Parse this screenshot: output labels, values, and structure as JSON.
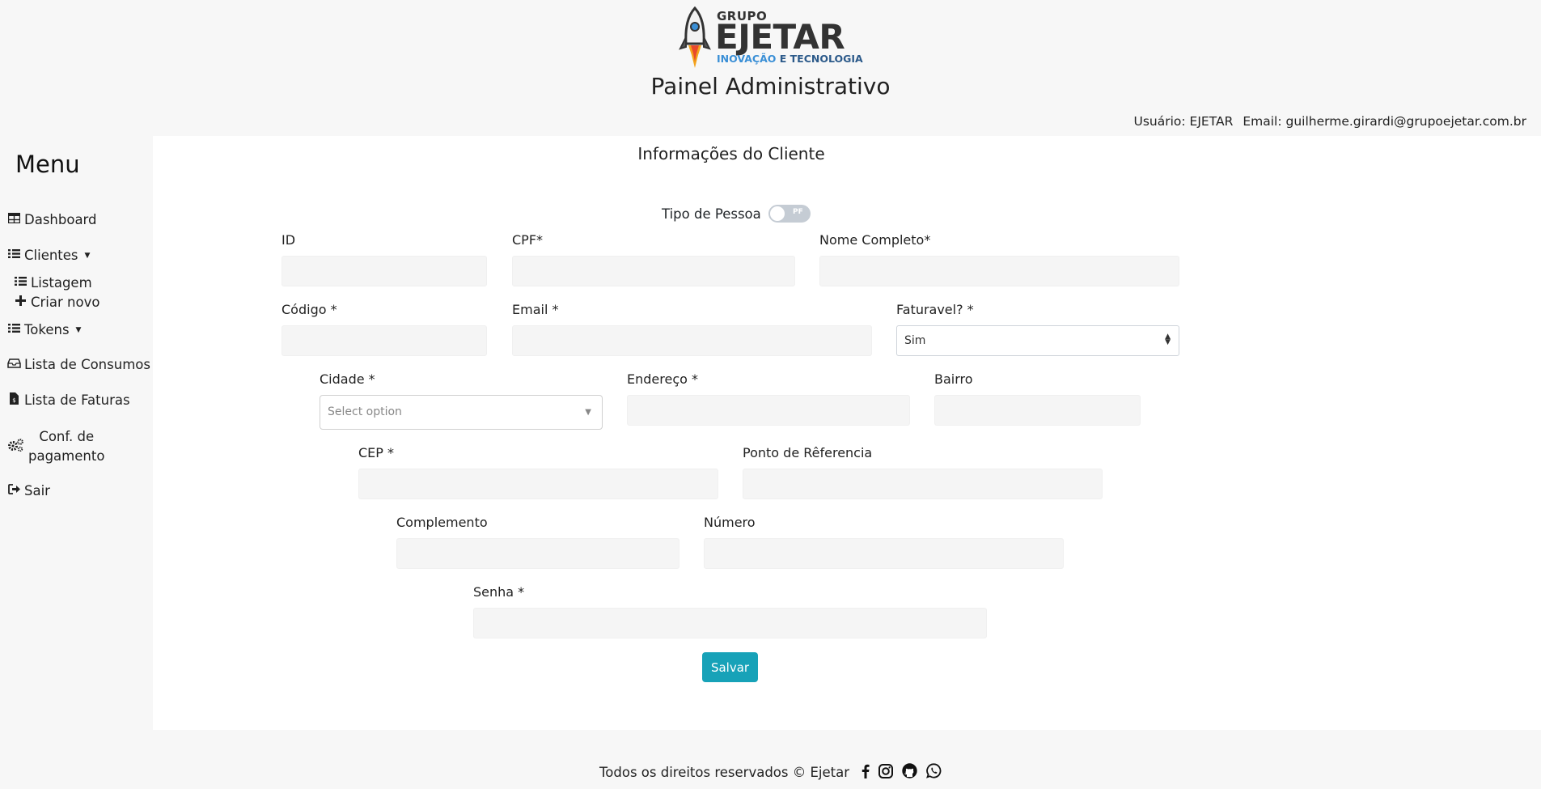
{
  "header": {
    "logo_top": "GRUPO",
    "logo_main": "EJETAR",
    "logo_tag_a": "INOVAÇÃO",
    "logo_tag_b": "E TECNOLOGIA",
    "title": "Painel Administrativo",
    "user_label": "Usuário: EJETAR",
    "email_label": "Email: guilherme.girardi@grupoejetar.com.br"
  },
  "sidebar": {
    "title": "Menu",
    "items": [
      {
        "label": "Dashboard",
        "icon": "table-icon"
      },
      {
        "label": "Clientes",
        "icon": "list-icon"
      },
      {
        "label": "Listagem",
        "icon": "list-icon"
      },
      {
        "label": "Criar novo",
        "icon": "plus-icon"
      },
      {
        "label": "Tokens",
        "icon": "list-icon"
      },
      {
        "label": "Lista de Consumos",
        "icon": "inbox-icon"
      },
      {
        "label": "Lista de Faturas",
        "icon": "file-invoice-icon"
      },
      {
        "label": "Conf. de",
        "label2": "pagamento",
        "icon": "gears-icon"
      },
      {
        "label": "Sair",
        "icon": "sign-out-icon"
      }
    ]
  },
  "form": {
    "section_title": "Informações do Cliente",
    "toggle_label": "Tipo de Pessoa",
    "toggle_value": "PF",
    "fields": {
      "id": "ID",
      "cpf": "CPF*",
      "nome": "Nome Completo*",
      "codigo": "Código *",
      "email": "Email *",
      "faturavel": "Faturavel? *",
      "faturavel_value": "Sim",
      "cidade": "Cidade *",
      "cidade_placeholder": "Select option",
      "endereco": "Endereço *",
      "bairro": "Bairro",
      "cep": "CEP *",
      "ponto": "Ponto de Rêferencia",
      "complemento": "Complemento",
      "numero": "Número",
      "senha": "Senha *"
    },
    "save_label": "Salvar"
  },
  "footer": {
    "text": "Todos os direitos reservados © Ejetar"
  },
  "colors": {
    "accent": "#17a2b8",
    "background": "#f7f7f7",
    "panel": "#ffffff"
  }
}
